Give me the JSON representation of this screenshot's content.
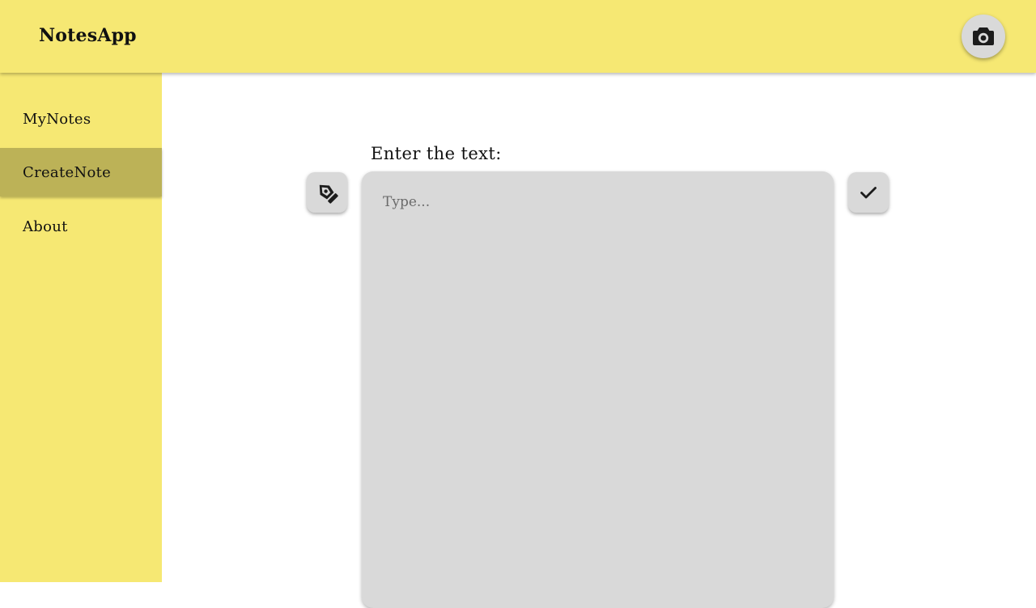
{
  "header": {
    "title": "NotesApp",
    "camera_icon": "camera-icon"
  },
  "sidebar": {
    "items": [
      {
        "label": "MyNotes",
        "active": false
      },
      {
        "label": "CreateNote",
        "active": true
      },
      {
        "label": "About",
        "active": false
      }
    ]
  },
  "editor": {
    "label": "Enter the text:",
    "placeholder": "Type...",
    "value": "",
    "left_icon": "pen-tool-icon",
    "right_icon": "checkmark-icon"
  },
  "colors": {
    "header_bg": "#f6e873",
    "sidebar_bg": "#f6e873",
    "sidebar_active_bg": "#bcb257",
    "control_bg": "#d9d9d9"
  }
}
